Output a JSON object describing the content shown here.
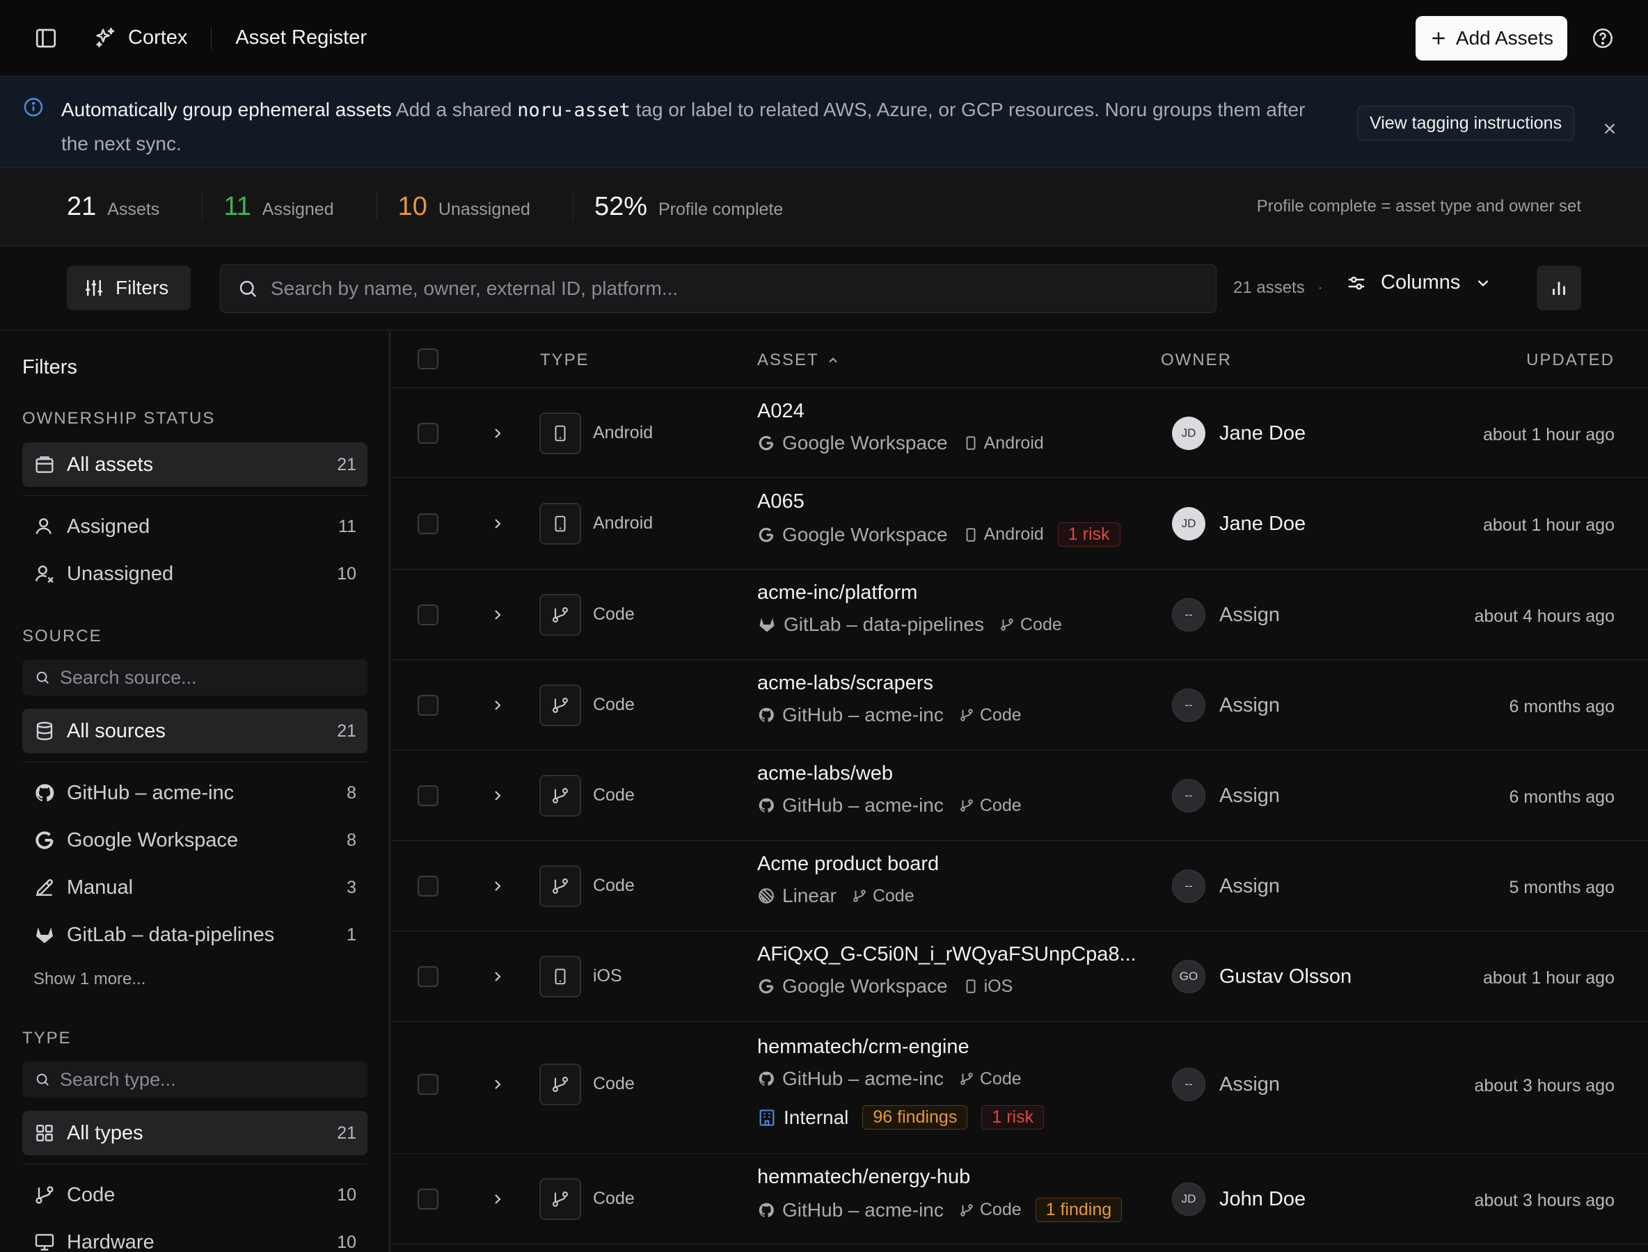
{
  "header": {
    "brand": "Cortex",
    "page_title": "Asset Register",
    "add_button": "Add Assets"
  },
  "banner": {
    "title": "Automatically group ephemeral assets",
    "text_before": "Add a shared",
    "code": "noru-asset",
    "text_after": "tag or label to related AWS, Azure, or GCP resources. Noru groups them after the next sync.",
    "button": "View tagging instructions"
  },
  "stats": {
    "items": [
      {
        "num": "21",
        "label": "Assets"
      },
      {
        "num": "11",
        "label": "Assigned"
      },
      {
        "num": "10",
        "label": "Unassigned"
      },
      {
        "num": "52%",
        "label": "Profile complete"
      }
    ],
    "note": "Profile complete = asset type and owner set"
  },
  "toolbar": {
    "filters": "Filters",
    "search_placeholder": "Search by name, owner, external ID, platform...",
    "count": "21 assets",
    "dot": "·",
    "columns": "Columns"
  },
  "sidebar": {
    "title": "Filters",
    "ownership_heading": "OWNERSHIP STATUS",
    "all_assets": {
      "label": "All assets",
      "count": "21"
    },
    "ownership": [
      {
        "label": "Assigned",
        "count": "11"
      },
      {
        "label": "Unassigned",
        "count": "10"
      }
    ],
    "source_heading": "SOURCE",
    "source_search_placeholder": "Search source...",
    "all_sources": {
      "label": "All sources",
      "count": "21"
    },
    "sources": [
      {
        "label": "GitHub – acme-inc",
        "count": "8",
        "icon": "github-icon"
      },
      {
        "label": "Google Workspace",
        "count": "8",
        "icon": "google-icon"
      },
      {
        "label": "Manual",
        "count": "3",
        "icon": "pencil-icon"
      },
      {
        "label": "GitLab – data-pipelines",
        "count": "1",
        "icon": "gitlab-icon"
      }
    ],
    "show_more": "Show 1 more...",
    "type_heading": "TYPE",
    "type_search_placeholder": "Search type...",
    "all_types": {
      "label": "All types",
      "count": "21"
    },
    "types": [
      {
        "label": "Code",
        "count": "10"
      },
      {
        "label": "Hardware",
        "count": "10"
      }
    ]
  },
  "table": {
    "columns": {
      "type": "TYPE",
      "asset": "ASSET",
      "owner": "OWNER",
      "updated": "UPDATED"
    },
    "rows": [
      {
        "type": "Android",
        "name": "A024",
        "source": "Google Workspace",
        "sub": "Android",
        "owner": "Jane Doe",
        "initials": "JD",
        "updated": "about 1 hour ago"
      },
      {
        "type": "Android",
        "name": "A065",
        "source": "Google Workspace",
        "sub": "Android",
        "badge": "1 risk",
        "owner": "Jane Doe",
        "initials": "JD",
        "updated": "about 1 hour ago"
      },
      {
        "type": "Code",
        "name": "acme-inc/platform",
        "source": "GitLab – data-pipelines",
        "sub": "Code",
        "owner": "Assign",
        "initials": "--",
        "updated": "about 4 hours ago"
      },
      {
        "type": "Code",
        "name": "acme-labs/scrapers",
        "source": "GitHub – acme-inc",
        "sub": "Code",
        "owner": "Assign",
        "initials": "--",
        "updated": "6 months ago"
      },
      {
        "type": "Code",
        "name": "acme-labs/web",
        "source": "GitHub – acme-inc",
        "sub": "Code",
        "owner": "Assign",
        "initials": "--",
        "updated": "6 months ago"
      },
      {
        "type": "Code",
        "name": "Acme product board",
        "source": "Linear",
        "sub": "Code",
        "owner": "Assign",
        "initials": "--",
        "updated": "5 months ago"
      },
      {
        "type": "iOS",
        "name": "AFiQxQ_G-C5i0N_i_rWQyaFSUnpCpa8...",
        "source": "Google Workspace",
        "sub": "iOS",
        "owner": "Gustav Olsson",
        "initials": "GO",
        "updated": "about 1 hour ago"
      },
      {
        "type": "Code",
        "name": "hemmatech/crm-engine",
        "source": "GitHub – acme-inc",
        "sub": "Code",
        "internal": "Internal",
        "badge_findings": "96 findings",
        "badge": "1 risk",
        "owner": "Assign",
        "initials": "--",
        "updated": "about 3 hours ago"
      },
      {
        "type": "Code",
        "name": "hemmatech/energy-hub",
        "source": "GitHub – acme-inc",
        "sub": "Code",
        "badge_findings": "1 finding",
        "owner": "John Doe",
        "initials": "JD",
        "updated": "about 3 hours ago"
      }
    ]
  }
}
